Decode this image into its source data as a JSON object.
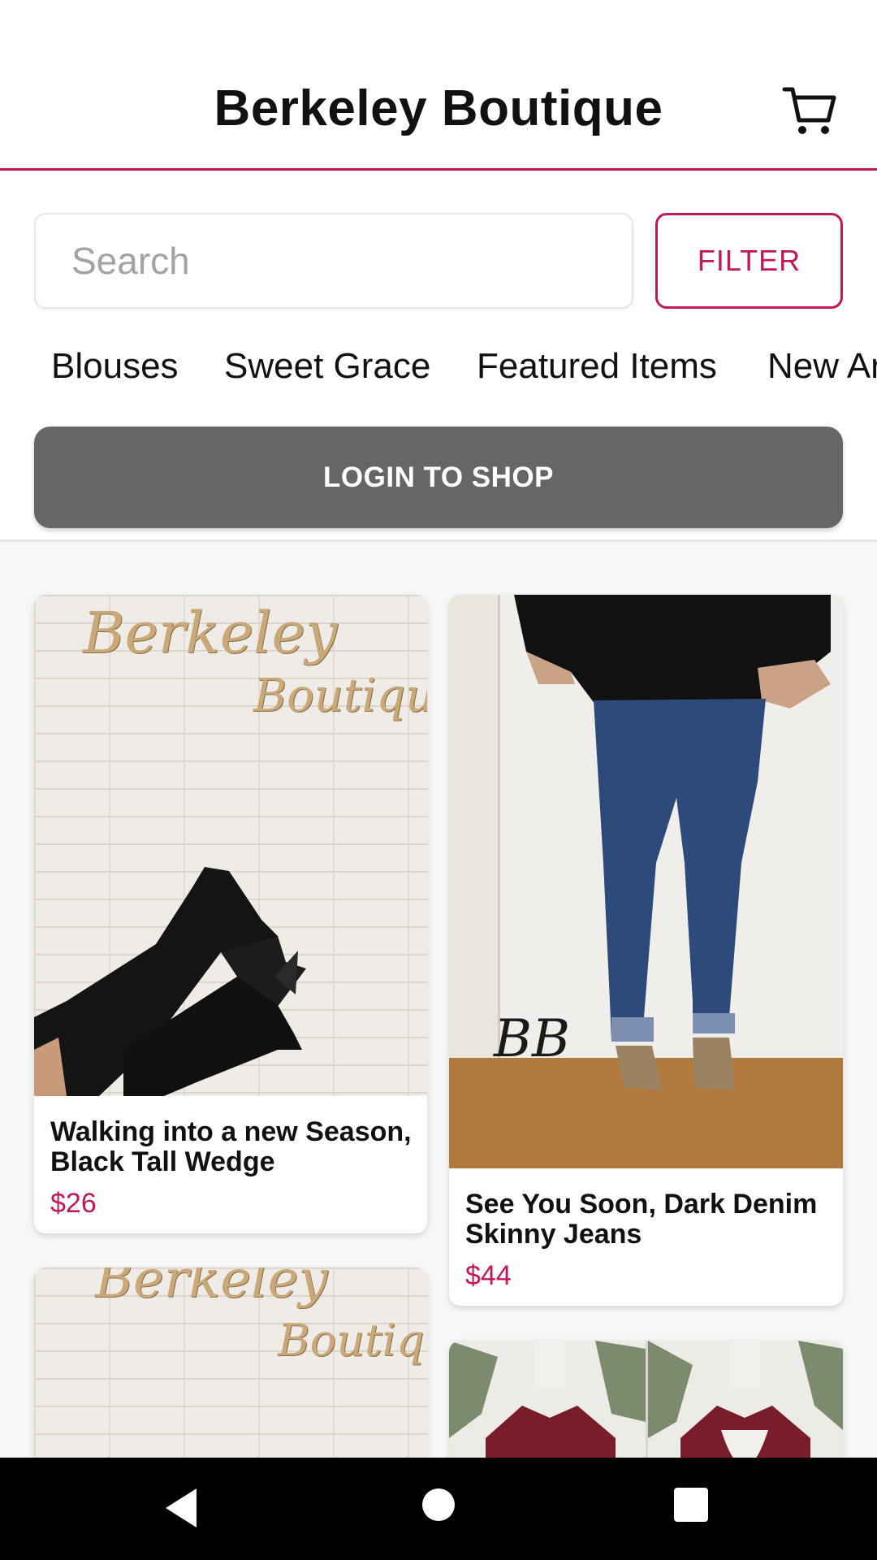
{
  "app": {
    "title": "Berkeley Boutique"
  },
  "header": {
    "cart_icon": "cart-icon"
  },
  "search": {
    "placeholder": "Search"
  },
  "filter": {
    "label": "FILTER"
  },
  "categories": [
    "Blouses",
    "Sweet Grace",
    "Featured Items",
    "New Ar"
  ],
  "login": {
    "label": "LOGIN TO SHOP"
  },
  "products": [
    {
      "title": "Walking into a new Season, Black Tall Wedge",
      "price": "$26"
    },
    {
      "title": "See You Soon, Dark Denim Skinny Jeans",
      "price": "$44"
    }
  ],
  "image_lettering": {
    "brand_script_1": "Berkeley",
    "brand_script_2": "Boutique",
    "monogram": "BB"
  },
  "colors": {
    "accent": "#c2185b",
    "login_bg": "#666666",
    "background": "#f7f7f7"
  },
  "navbar": {
    "icons": [
      "back-icon",
      "home-icon",
      "recents-icon"
    ]
  }
}
